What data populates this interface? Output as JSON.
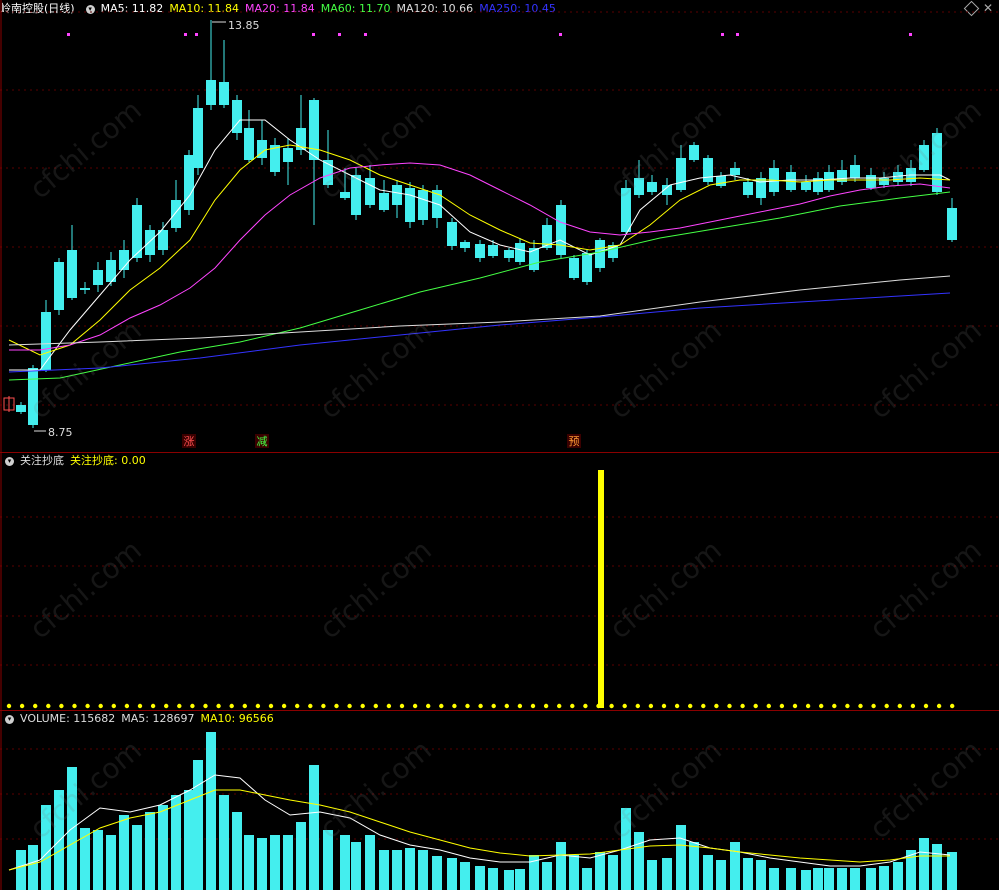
{
  "main": {
    "stock_name": "岭南控股",
    "period": "(日线)",
    "indicators": [
      {
        "label": "MA5: 11.82",
        "color": "#ffffff"
      },
      {
        "label": "MA10: 11.84",
        "color": "#ffff00"
      },
      {
        "label": "MA20: 11.84",
        "color": "#ff44ff"
      },
      {
        "label": "MA60: 11.70",
        "color": "#44ff44"
      },
      {
        "label": "MA120: 10.66",
        "color": "#dddddd"
      },
      {
        "label": "MA250: 10.45",
        "color": "#3333ff"
      }
    ],
    "high_label": "13.85",
    "low_label": "8.75",
    "signals": [
      "涨",
      "减",
      "预"
    ]
  },
  "indicator_panel": {
    "title": "关注抄底",
    "value_label": "关注抄底: 0.00"
  },
  "volume_panel": {
    "label": "VOLUME: 115682",
    "ma5": "MA5: 128697",
    "ma10": "MA10: 96566"
  },
  "watermark": "cfchi.com",
  "colors": {
    "up": "#ff5050",
    "down": "#44eeee",
    "grid": "#8a0000",
    "signal_bar": "#ffff00"
  }
}
